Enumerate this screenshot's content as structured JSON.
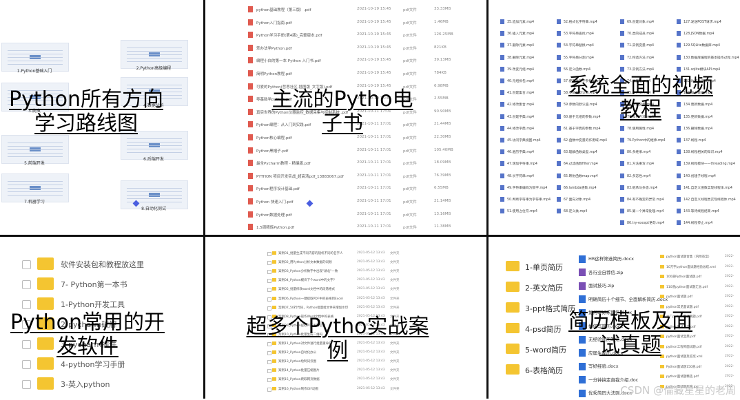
{
  "captions": {
    "roadmap": "Python所有方向学习路线图",
    "ebooks": "主流的Pytho电子书",
    "videos": "系统全面的视频教程",
    "tools": "Python常用的开发软件",
    "cases": "超多个Pytho实战案例",
    "resume": "简历模板及面试真题"
  },
  "roadmap_labels": [
    "1.Python基础入门",
    "2.Python高级编程",
    "3.爬虫",
    "4.数据分析",
    "5.前端开发",
    "6.后端开发",
    "7.机器学习",
    "8.自动化测试"
  ],
  "ebooks": [
    {
      "name": "python基础教程（第三版）.pdf",
      "date": "2021-10-19 15:45",
      "type": "pdf文件",
      "size": "33.33MB"
    },
    {
      "name": "Python入门指南.pdf",
      "date": "2021-10-19 15:45",
      "type": "pdf文件",
      "size": "1.46MB"
    },
    {
      "name": "Python学习手册(第4版)_完整版本.pdf",
      "date": "2021-10-19 15:45",
      "type": "pdf文件",
      "size": "126.25MB"
    },
    {
      "name": "笨办法学Python.pdf",
      "date": "2021-10-19 15:45",
      "type": "pdf文件",
      "size": "821KB"
    },
    {
      "name": "编程小白的第一本 Python 入门书.pdf",
      "date": "2021-10-19 15:45",
      "type": "pdf文件",
      "size": "39.13MB"
    },
    {
      "name": "简明Python教程.pdf",
      "date": "2021-10-19 15:45",
      "type": "pdf文件",
      "size": "784KB"
    },
    {
      "name": "可爱的Python(哲思社区.插图版_文字版).pdf",
      "date": "2021-10-19 15:45",
      "type": "pdf文件",
      "size": "6.98MB"
    },
    {
      "name": "零基础学python.pdf",
      "date": "2021-10-19 15:45",
      "type": "pdf文件",
      "size": "2.55MB"
    },
    {
      "name": "真实世界的Python仪器监控_数据采集与控制系统..pdf",
      "date": "2021-10-11 17:01",
      "type": "pdf文件",
      "size": "90.90MB"
    },
    {
      "name": "Python编程：从入门到实践.pdf",
      "date": "2021-10-11 17:01",
      "type": "pdf文件",
      "size": "21.44MB"
    },
    {
      "name": "Python核心编程.pdf",
      "date": "2021-10-11 17:01",
      "type": "pdf文件",
      "size": "22.30MB"
    },
    {
      "name": "Python黑帽子.pdf",
      "date": "2021-10-11 17:01",
      "type": "pdf文件",
      "size": "105.40MB"
    },
    {
      "name": "最全Pycharm教程 - 精编版.pdf",
      "date": "2021-10-11 17:01",
      "type": "pdf文件",
      "size": "18.09MB"
    },
    {
      "name": "PYTHON 项目开发实战_超高清pdf_13883067.pdf",
      "date": "2021-10-11 17:01",
      "type": "pdf文件",
      "size": "76.39MB"
    },
    {
      "name": "Python程序设计基础.pdf",
      "date": "2021-10-11 17:01",
      "type": "pdf文件",
      "size": "6.55MB"
    },
    {
      "name": "Python 快速入门.pdf",
      "date": "2021-10-11 17:01",
      "type": "pdf文件",
      "size": "21.14MB"
    },
    {
      "name": "Python数据处理.pdf",
      "date": "2021-10-11 17:01",
      "type": "pdf文件",
      "size": "13.16MB"
    },
    {
      "name": "1.5周精炼Python.pdf",
      "date": "2021-10-11 17:01",
      "type": "pdf文件",
      "size": "11.38MB"
    }
  ],
  "videos": {
    "col1": [
      "35.追加元素.mp4",
      "36.插入元素.mp4",
      "37.删除元素.mp4",
      "38.删除元素.mp4",
      "39.改变元组.mp4",
      "40.元组拆包.mp4",
      "41.创建集合.mp4",
      "42.修改集合.mp4",
      "43.创建字典.mp4",
      "44.修改字典.mp4",
      "45.访问字典视图.mp4",
      "46.遍历字典.mp4",
      "47.增加字符串.mp4",
      "48.长字符串.mp4",
      "49.字符串编码为数字.mp4",
      "50.判断字符串为字符串.mp4",
      "51.使用占位符.mp4"
    ],
    "col2": [
      "52.格式化字符串.mp4",
      "53.字符串查找.mp4",
      "54.字符串替换.mp4",
      "55.字符串分割.mp4",
      "56.定义函数.mp4",
      "57.使用关键字参数.mp4",
      "58.参数的默认值.mp4",
      "59.参数的默认值.mp4",
      "60.基于元组的参数.mp4",
      "61.基于字典的参数.mp4",
      "62.函数中变量的作用域.mp4",
      "63.理解函数类型.mp4",
      "64.过滤函数filter.mp4",
      "65.映射函数map.mp4",
      "66.lambda函数.mp4",
      "67.面向对象.mp4",
      "68.定义类.mp4"
    ],
    "col3": [
      "69.创建对象.mp4",
      "70.类的成员.mp4",
      "71.实例变量.mp4",
      "72.构造方法.mp4",
      "73.实例方法.mp4",
      "74.类变量.mp4",
      "75.类方法.mp4",
      "76.私有变量.mp4",
      "77.私有方法.mp4",
      "78.使用属性.mp4",
      "79.Python中的继承.mp4",
      "80.多继承.mp4",
      "81.方法重写.mp4",
      "82.多态性.mp4",
      "83.继承与多态.mp4",
      "84.有不确定的异常.mp4",
      "85.第一个异常处理.mp4",
      "86.try-except语句.mp4"
    ],
    "col4": [
      "127.发送POST请求.mp4",
      "128.JSON数据.mp4",
      "129.SQLite数据库.mp4",
      "130.数据库编程的基本操作过程.mp4",
      "131.sqlite模块API.mp4",
      "132.访问数据库.mp4",
      "133.插入数据.mp4",
      "134.更新数据.mp4",
      "135.更新数据.mp4",
      "136.删除数据.mp4",
      "137.线程.mp4",
      "138.线程相关的知识.mp4",
      "139.线程模块——threading.mp4",
      "140.创建子线程.mp4",
      "141.自定义函数实现线程体.mp4",
      "142.自定义线程类实现线程体.mp4",
      "143.等待线程结束.mp4",
      "144.线程停止.mp4"
    ]
  },
  "tools": [
    "软件安装包和教程放这里",
    "7- Python第一本书",
    "1-Python开发工具",
    "2-pycharm破解",
    "3-pycharm插件",
    "4-python学习手册",
    "3-英入python"
  ],
  "cases": [
    {
      "name": "案例01_批量生成不同内容的随机不同的名字人",
      "date": "2021-05-12 13:43",
      "type": "文件夹"
    },
    {
      "name": "案例02_用Python分析文本数据的词频",
      "date": "2021-05-12 13:43",
      "type": "文件夹"
    },
    {
      "name": "案例03_Python分析数字中出现\"湖北\"一致",
      "date": "2021-05-12 13:43",
      "type": "文件夹"
    },
    {
      "name": "案例04_Python模块下个word中的文字?",
      "date": "2021-05-12 13:43",
      "type": "文件夹"
    },
    {
      "name": "案例05_批量修改word文档中的段落格式",
      "date": "2021-05-12 13:43",
      "type": "文件夹"
    },
    {
      "name": "案例06_Python一键提取PDF中的表格到Excel",
      "date": "2021-05-12 13:43",
      "type": "文件夹"
    },
    {
      "name": "案例07_50行代码，Python批量给文件夹增加水印",
      "date": "2021-05-12 13:43",
      "type": "文件夹"
    },
    {
      "name": "案例08_Python操作Word文档中的表格",
      "date": "2021-05-12 13:43",
      "type": "文件夹"
    },
    {
      "name": "案例09_Python提取PDF发票信息",
      "date": "2021-05-12 13:43",
      "type": "文件夹"
    },
    {
      "name": "案例10_Python批量生成二维码",
      "date": "2021-05-12 13:43",
      "type": "文件夹"
    },
    {
      "name": "案例11_Python对文件进行批量重命名",
      "date": "2021-05-12 13:43",
      "type": "文件夹"
    },
    {
      "name": "案例12_Python自动化办公",
      "date": "2021-05-12 13:43",
      "type": "文件夹"
    },
    {
      "name": "案例13_Python绘制词云图",
      "date": "2021-05-12 13:43",
      "type": "文件夹"
    },
    {
      "name": "案例14_Python批量压缩图片",
      "date": "2021-05-12 13:43",
      "type": "文件夹"
    },
    {
      "name": "案例15_Python爬取网页数据",
      "date": "2021-05-12 13:43",
      "type": "文件夹"
    },
    {
      "name": "案例16_Python制作GIF动图",
      "date": "2021-05-12 13:43",
      "type": "文件夹"
    }
  ],
  "resume_folders": [
    "1-单页简历",
    "2-英文简历",
    "3-ppt格式简历",
    "4-psd简历",
    "5-word简历",
    "6-表格简历"
  ],
  "resume_files": [
    {
      "name": "HR这样筛选简历.docx",
      "color": "#2f6fd6"
    },
    {
      "name": "各行业自荐信.zip",
      "color": "#7a4fb5"
    },
    {
      "name": "面试技巧.zip",
      "color": "#7a4fb5"
    },
    {
      "name": "明确简历十个细节、全面解析简历.docx",
      "color": "#2f6fd6"
    },
    {
      "name": "如何写好求职信.docx",
      "color": "#2f6fd6"
    },
    {
      "name": "如何写简历.docx",
      "color": "#2f6fd6"
    },
    {
      "name": "无经验简历写法.docx",
      "color": "#2f6fd6"
    },
    {
      "name": "应届生简历.docx",
      "color": "#2f6fd6"
    },
    {
      "name": "写好经验.docx",
      "color": "#2f6fd6"
    },
    {
      "name": "一分钟搞定自我介绍.doc",
      "color": "#2f6fd6"
    },
    {
      "name": "优秀简历大法则.docx",
      "color": "#2f6fd6"
    }
  ],
  "resume_col3": [
    "python面试题合集（内附答案）",
    "10万字python面试题经验总结.xml",
    "100道Python面试题.pdf",
    "110道python面试题汇总.pdf",
    "python面试题.pdf",
    "python常见面试题.pdf",
    "大厂python面试真题.pdf",
    "python面试大全.pdf",
    "python面试宝典.pdf",
    "python工程师面试题.pdf",
    "python面试题及答案.xml",
    "Python面试题150道.pdf",
    "python面试题精选.pdf",
    "python面试题集锦.jpg"
  ],
  "resume_col3_date": "2022-",
  "watermark": "CSDN @倫藏星星的老周"
}
